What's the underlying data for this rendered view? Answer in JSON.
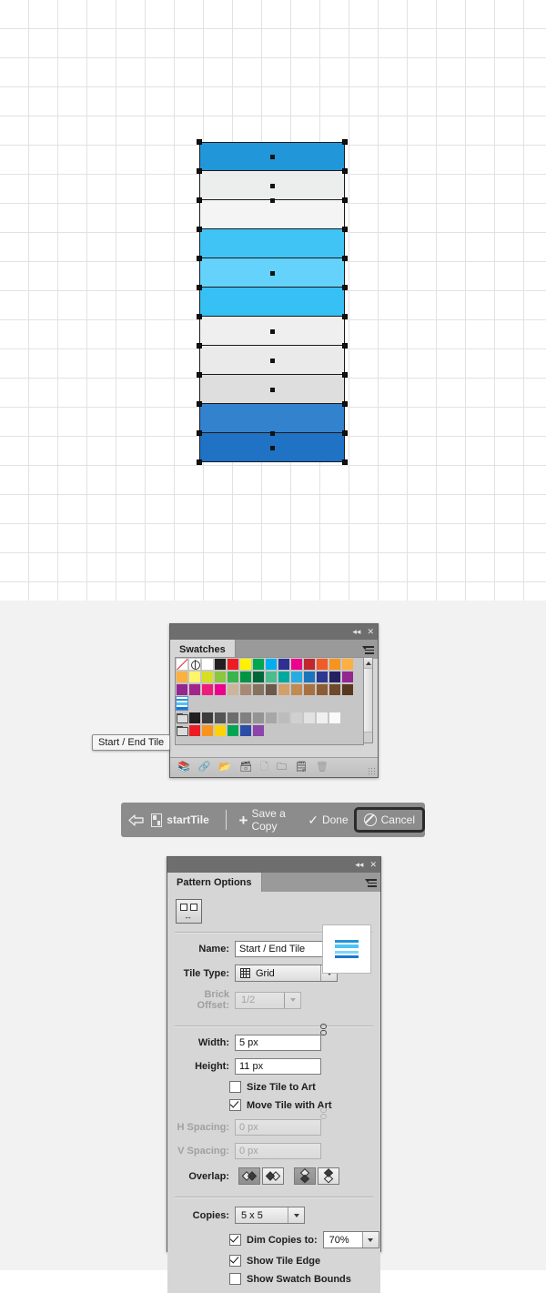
{
  "app": {
    "artwork": {
      "name": "pattern-stripe-artwork",
      "bands": [
        {
          "index": 1,
          "color": "#2196d9",
          "has_anchor": true
        },
        {
          "index": 2,
          "color": "#eceded",
          "has_anchor": true
        },
        {
          "index": 3,
          "color": "#f4f4f4",
          "has_anchor": false
        },
        {
          "index": 4,
          "color": "#40c4f5",
          "has_anchor": false
        },
        {
          "index": 5,
          "color": "#64d2fb",
          "has_anchor": true
        },
        {
          "index": 6,
          "color": "#36c0f4",
          "has_anchor": false
        },
        {
          "index": 7,
          "color": "#efefef",
          "has_anchor": true
        },
        {
          "index": 8,
          "color": "#eaeaea",
          "has_anchor": true
        },
        {
          "index": 9,
          "color": "#dedede",
          "has_anchor": true
        },
        {
          "index": 10,
          "color": "#3282cd",
          "has_anchor": false
        },
        {
          "index": 11,
          "color": "#1f72c4",
          "has_anchor": true
        }
      ]
    },
    "swatches_panel": {
      "title": "Swatches",
      "collapse_icon": "collapse-icon",
      "close_icon": "close-icon",
      "flyout_icon": "panel-menu-icon",
      "fill_swatch": "pattern-fill-swatch",
      "stroke_swatch": "none-stroke-swatch",
      "view_list_icon": "list-view-icon",
      "view_grid_icon": "grid-view-icon",
      "active_view": "grid",
      "rows": [
        [
          "none",
          "registration",
          "#ffffff",
          "#231f20",
          "#ed1c24",
          "#fff200",
          "#00a651",
          "#00aeef",
          "#2e3192",
          "#ec008c",
          "#c1272d",
          "#f15a29",
          "#f7941e",
          "#fbb040"
        ],
        [
          "#fbb040",
          "#fff568",
          "#d7df23",
          "#8dc63f",
          "#39b54a",
          "#009444",
          "#006838",
          "#4bbc8e",
          "#00a99d",
          "#29abe2",
          "#1c75bc",
          "#2b3990",
          "#262262",
          "#92278f"
        ],
        [
          "#92278f",
          "#a3238e",
          "#ed1e79",
          "#ec008c",
          "#cbb69b",
          "#a78a75",
          "#85725f",
          "#6b5a4a",
          "#d0a06b",
          "#c08a52",
          "#a97142",
          "#8d5c35",
          "#70482a",
          "#573720"
        ]
      ],
      "pattern_swatch_selected": "start-end-tile-swatch",
      "gray_row_folder": "color-group-folder",
      "gray_row": [
        "#231f20",
        "#3c3c3c",
        "#555555",
        "#6d6d6d",
        "#808080",
        "#949494",
        "#a7a7a7",
        "#bcbcbc",
        "#d0d0d0",
        "#e2e2e2",
        "#f0f0f0",
        "#fafafa"
      ],
      "bottom_row_folder": "color-group-folder",
      "bottom_row": [
        "#ed1c24",
        "#f7941e",
        "#fdd20a",
        "#00a651",
        "#2b4ca7",
        "#8c45a8"
      ],
      "toolbar_icons": [
        "swatch-libraries-icon",
        "link-color-harmony-icon",
        "show-swatch-kinds-icon",
        "swatch-options-icon",
        "list-options-icon",
        "new-color-group-icon",
        "new-swatch-icon",
        "delete-swatch-icon"
      ],
      "resize_grip": "resize-grip"
    },
    "tooltip": {
      "text": "Start / End Tile"
    },
    "pattern_toolbar": {
      "back_icon": "back-arrow-icon",
      "tile_icon": "pattern-tile-icon",
      "pattern_name": "startTile",
      "save_copy_icon": "plus-icon",
      "save_copy_label": "Save a Copy",
      "done_icon": "check-icon",
      "done_label": "Done",
      "cancel_icon": "cancel-ban-icon",
      "cancel_label": "Cancel",
      "cancel_highlighted": true
    },
    "pattern_options": {
      "title": "Pattern Options",
      "collapse_icon": "collapse-icon",
      "close_icon": "close-icon",
      "flyout_icon": "panel-menu-icon",
      "tile_tool_icon": "pattern-tile-tool-icon",
      "name_label": "Name:",
      "name_value": "Start / End Tile",
      "tile_type_label": "Tile Type:",
      "tile_type_value": "Grid",
      "tile_type_icon": "grid-tile-icon",
      "brick_offset_label": "Brick Offset:",
      "brick_offset_value": "1/2",
      "brick_offset_disabled": true,
      "preview_name": "tile-preview",
      "width_label": "Width:",
      "width_value": "5 px",
      "height_label": "Height:",
      "height_value": "11 px",
      "dimension_link_icon": "link-dimensions-icon",
      "size_tile_to_art_label": "Size Tile to Art",
      "size_tile_to_art_checked": false,
      "move_tile_with_art_label": "Move Tile with Art",
      "move_tile_with_art_checked": true,
      "h_spacing_label": "H Spacing:",
      "h_spacing_value": "0 px",
      "h_spacing_disabled": true,
      "v_spacing_label": "V Spacing:",
      "v_spacing_value": "0 px",
      "v_spacing_disabled": true,
      "spacing_link_icon": "link-spacing-icon",
      "overlap_label": "Overlap:",
      "overlap_buttons": [
        {
          "name": "overlap-left-in-front",
          "active": true
        },
        {
          "name": "overlap-right-in-front",
          "active": false
        },
        {
          "name": "overlap-bottom-in-front",
          "active": true
        },
        {
          "name": "overlap-top-in-front",
          "active": false
        }
      ],
      "copies_label": "Copies:",
      "copies_value": "5 x 5",
      "dim_copies_label": "Dim Copies to:",
      "dim_copies_checked": true,
      "dim_copies_value": "70%",
      "show_tile_edge_label": "Show Tile Edge",
      "show_tile_edge_checked": true,
      "show_swatch_bounds_label": "Show Swatch Bounds",
      "show_swatch_bounds_checked": false
    }
  }
}
